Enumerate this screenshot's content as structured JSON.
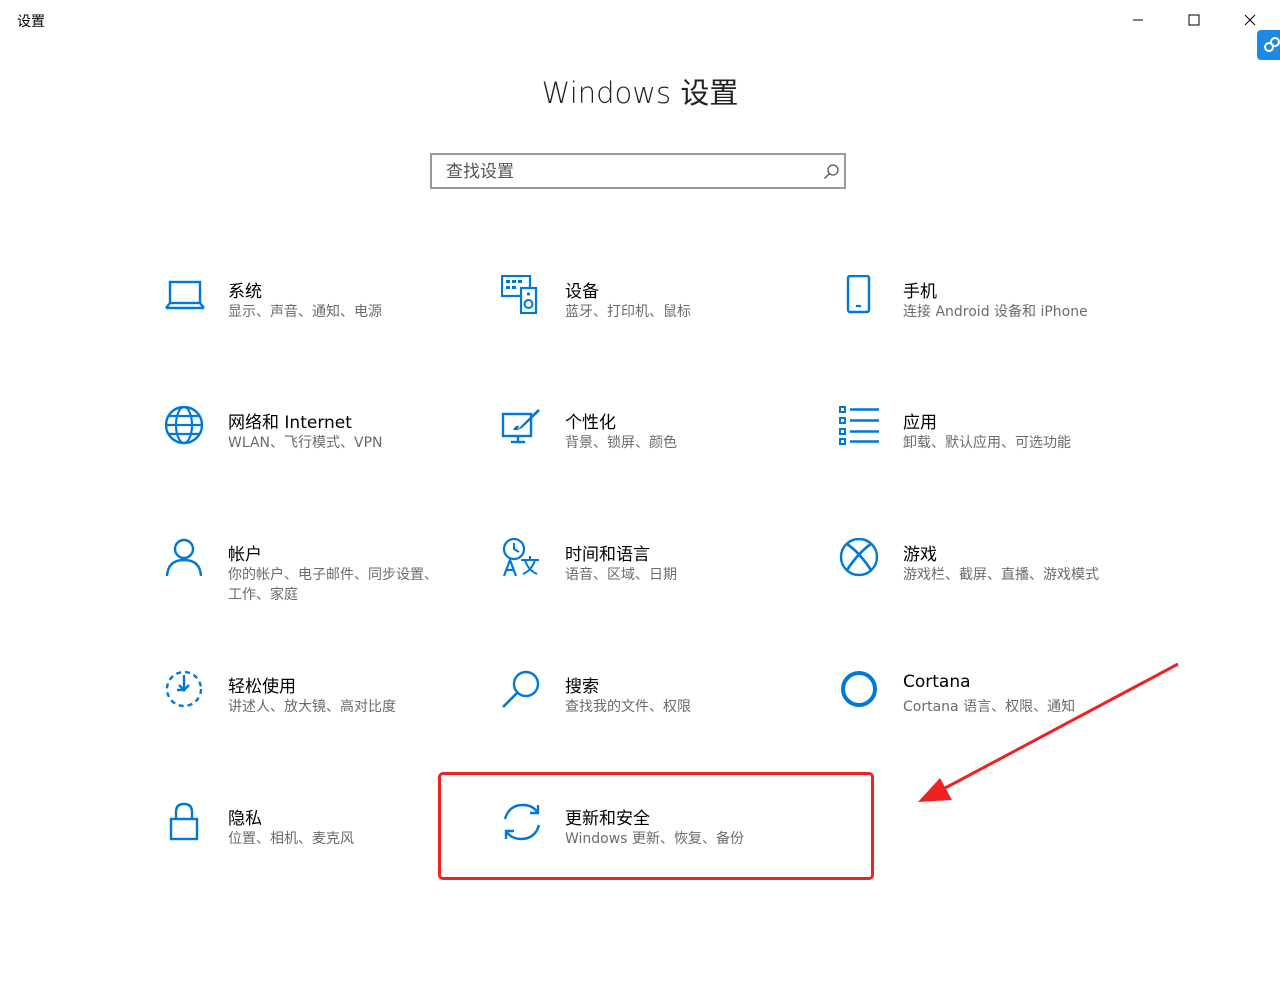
{
  "window": {
    "title": "设置",
    "controls": {
      "minimize_icon": "minimize-icon",
      "maximize_icon": "maximize-icon",
      "close_icon": "close-icon"
    }
  },
  "header": {
    "title": "Windows 设置"
  },
  "search": {
    "placeholder": "查找设置",
    "value": ""
  },
  "accent": "#0078d7",
  "annotation_color": "#ee2222",
  "tiles": [
    {
      "title": "系统",
      "subtitle": "显示、声音、通知、电源",
      "icon": "laptop-icon"
    },
    {
      "title": "设备",
      "subtitle": "蓝牙、打印机、鼠标",
      "icon": "keyboard-speaker-icon"
    },
    {
      "title": "手机",
      "subtitle": "连接 Android 设备和 iPhone",
      "icon": "phone-icon"
    },
    {
      "title": "网络和 Internet",
      "subtitle": "WLAN、飞行模式、VPN",
      "icon": "globe-icon"
    },
    {
      "title": "个性化",
      "subtitle": "背景、锁屏、颜色",
      "icon": "paint-brush-icon"
    },
    {
      "title": "应用",
      "subtitle": "卸载、默认应用、可选功能",
      "icon": "apps-list-icon"
    },
    {
      "title": "帐户",
      "subtitle": "你的帐户、电子邮件、同步设置、工作、家庭",
      "icon": "person-icon"
    },
    {
      "title": "时间和语言",
      "subtitle": "语音、区域、日期",
      "icon": "time-language-icon"
    },
    {
      "title": "游戏",
      "subtitle": "游戏栏、截屏、直播、游戏模式",
      "icon": "xbox-icon"
    },
    {
      "title": "轻松使用",
      "subtitle": "讲述人、放大镜、高对比度",
      "icon": "ease-of-access-icon"
    },
    {
      "title": "搜索",
      "subtitle": "查找我的文件、权限",
      "icon": "search-icon"
    },
    {
      "title": "Cortana",
      "subtitle": "Cortana 语言、权限、通知",
      "icon": "cortana-icon"
    },
    {
      "title": "隐私",
      "subtitle": "位置、相机、麦克风",
      "icon": "lock-icon"
    },
    {
      "title": "更新和安全",
      "subtitle": "Windows 更新、恢复、备份",
      "icon": "sync-icon"
    }
  ]
}
